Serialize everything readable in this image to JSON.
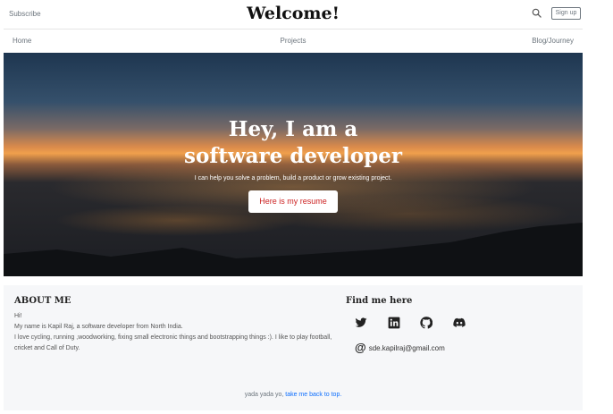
{
  "header": {
    "subscribe_label": "Subscribe",
    "site_title": "Welcome!",
    "search_icon": "search-icon",
    "signup_label": "Sign up"
  },
  "nav": {
    "items": [
      {
        "label": "Home"
      },
      {
        "label": "Projects"
      },
      {
        "label": "Blog/Journey"
      }
    ]
  },
  "hero": {
    "title": "Hey, I am a software developer",
    "subtitle": "I can help you solve a problem, build a product or grow existing project.",
    "button_label": "Here is my resume",
    "button_text_color": "#cc2222"
  },
  "about": {
    "heading": "ABOUT ME",
    "lines": [
      "Hi!",
      "My name is Kapil Raj, a software developer from North India.",
      "I love cycling, running ,woodworking, fixing small electronic things and bootstrapping things :). I like to play football, cricket and Call of Duty."
    ]
  },
  "contact": {
    "heading": "Find me here",
    "socials": [
      "twitter-icon",
      "linkedin-icon",
      "github-icon",
      "discord-icon"
    ],
    "email_icon": "at-icon",
    "email": "sde.kapilraj@gmail.com"
  },
  "footer": {
    "note_prefix": "yada yada yo,",
    "note_link": "take me back to top."
  },
  "colors": {
    "link": "#0d6efd",
    "muted_text": "#6c757d",
    "footer_bg": "#f6f7f9"
  }
}
